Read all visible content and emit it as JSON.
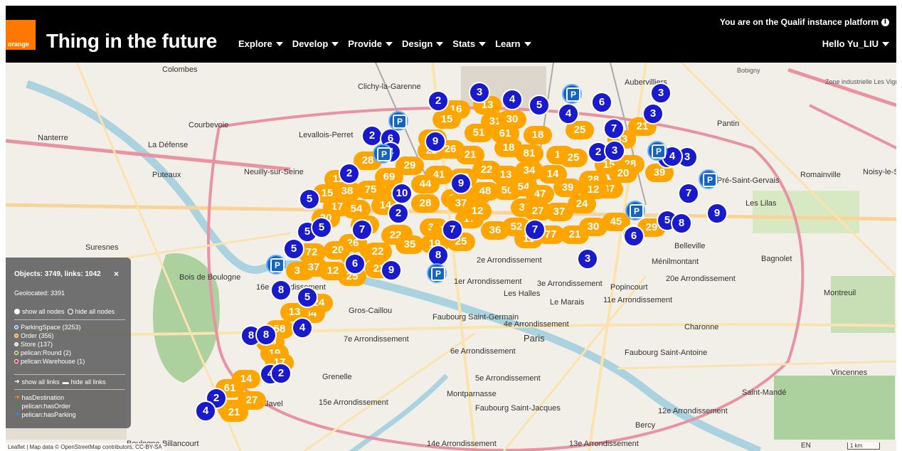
{
  "header": {
    "logo_text": "orange",
    "brand": "Thing in the future",
    "menu": [
      "Explore",
      "Develop",
      "Provide",
      "Design",
      "Stats",
      "Learn"
    ],
    "instance_notice": "You are on the Qualif instance platform",
    "user": "Hello Yu_LIU"
  },
  "map": {
    "places": [
      "Colombes",
      "Clichy-la-Garenne",
      "Nanterre",
      "Courbevoie",
      "Levallois-Perret",
      "La Défense",
      "Puteaux",
      "Neuilly-sur-Seine",
      "Suresnes",
      "Bois de Boulogne",
      "Boulogne-Billancourt",
      "Pantin",
      "Noisy-le-Sec",
      "Romainville",
      "Les Lilas",
      "Bagnolet",
      "Montreuil",
      "Ménilmontant",
      "Belleville",
      "20e Arrondissement",
      "Popincourt",
      "11e Arrondissement",
      "Le Marais",
      "Les Halles",
      "3e Arrondissement",
      "2e Arrondissement",
      "1er Arrondissement",
      "Paris",
      "4e Arrondissement",
      "6e Arrondissement",
      "Faubourg Saint-Germain",
      "Gros-Caillou",
      "7e Arrondissement",
      "Grenelle",
      "15e Arrondissement",
      "Javel",
      "Montparnasse",
      "5e Arrondissement",
      "Faubourg Saint-Jacques",
      "14e Arrondissement",
      "13e Arrondissement",
      "Charonne",
      "Faubourg Saint-Antoine",
      "12e Arrondissement",
      "Bercy",
      "Saint-Mandé",
      "Vincennes",
      "Bobigny",
      "Zone industrielle Les Vignes",
      "Aubervilliers",
      "16e Arrondissement",
      "Pré-Saint-Gervais"
    ],
    "orange_clusters": [
      "16",
      "13",
      "15",
      "31",
      "30",
      "51",
      "61",
      "18",
      "34",
      "21",
      "18",
      "81",
      "16",
      "25",
      "33",
      "21",
      "22",
      "26",
      "28",
      "69",
      "29",
      "41",
      "23",
      "22",
      "13",
      "34",
      "14",
      "25",
      "15",
      "28",
      "20",
      "39",
      "12",
      "15",
      "38",
      "75",
      "10",
      "44",
      "15",
      "9",
      "48",
      "50",
      "54",
      "47",
      "39",
      "28",
      "37",
      "17",
      "54",
      "14",
      "28",
      "37",
      "36",
      "27",
      "37",
      "24",
      "12",
      "45",
      "18",
      "15",
      "22",
      "30",
      "7",
      "17",
      "12",
      "36",
      "52",
      "11",
      "77",
      "21",
      "30",
      "29",
      "20",
      "26",
      "20",
      "69",
      "22",
      "35",
      "19",
      "25",
      "72",
      "36",
      "37",
      "12",
      "25",
      "22",
      "34",
      "13",
      "24",
      "58",
      "30",
      "19",
      "14",
      "17",
      "61",
      "14",
      "27",
      "21",
      "27"
    ],
    "blue_clusters": [
      "2",
      "3",
      "4",
      "5",
      "4",
      "6",
      "3",
      "2",
      "6",
      "9",
      "4",
      "7",
      "2",
      "3",
      "3",
      "4",
      "3",
      "4",
      "6",
      "5",
      "5",
      "5",
      "2",
      "7",
      "10",
      "9",
      "7",
      "7",
      "9",
      "6",
      "2",
      "8",
      "5",
      "5",
      "8",
      "8",
      "5",
      "9",
      "3",
      "7",
      "8",
      "6",
      "4",
      "8",
      "4",
      "2",
      "4",
      "2"
    ],
    "attribution": "Leaflet | Map data © OpenStreetMap contributors, CC-BY-SA",
    "lang": "EN",
    "scale": "1 km"
  },
  "panel": {
    "title": "Objects: 3749, links: 1042",
    "close": "×",
    "geolocated": "Geolocated: 3391",
    "show_nodes": "show all nodes",
    "hide_nodes": "hide all nodes",
    "node_types": [
      {
        "label": "ParkingSpace (3253)",
        "color": "#4aa3df"
      },
      {
        "label": "Order (356)",
        "color": "#ff8c00"
      },
      {
        "label": "Store (137)",
        "color": "#d8d8d8"
      },
      {
        "label": "pelican:Round (2)",
        "color": "#6b8e23"
      },
      {
        "label": "pelican:Warehouse (1)",
        "color": "#e0213a"
      }
    ],
    "show_links": "show all links",
    "hide_links": "hide all links",
    "link_types": [
      {
        "label": "hasDestination",
        "color": "#ff8c00"
      },
      {
        "label": "pelican:hasOrder",
        "color": "#2e8b57"
      },
      {
        "label": "pelican:hasParking",
        "color": "#1e90ff"
      }
    ]
  }
}
